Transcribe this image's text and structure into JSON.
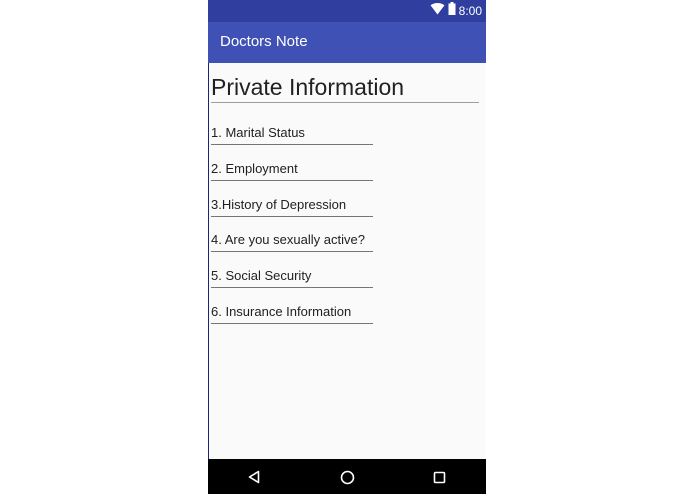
{
  "status_bar": {
    "time": "8:00",
    "icons": [
      "wifi-icon",
      "battery-icon"
    ]
  },
  "app_bar": {
    "title": "Doctors Note"
  },
  "main": {
    "title": "Private Information",
    "items": [
      {
        "label": "1. Marital Status"
      },
      {
        "label": "2. Employment"
      },
      {
        "label": "3.History of  Depression"
      },
      {
        "label": "4. Are you sexually active?"
      },
      {
        "label": "5. Social Security"
      },
      {
        "label": "6. Insurance Information"
      }
    ]
  },
  "nav_bar": {
    "icons": [
      "back-icon",
      "home-icon",
      "recents-icon"
    ]
  },
  "colors": {
    "status_bar": "#303f9f",
    "app_bar": "#3f51b5",
    "background": "#fafafa",
    "nav_bar": "#000000"
  }
}
